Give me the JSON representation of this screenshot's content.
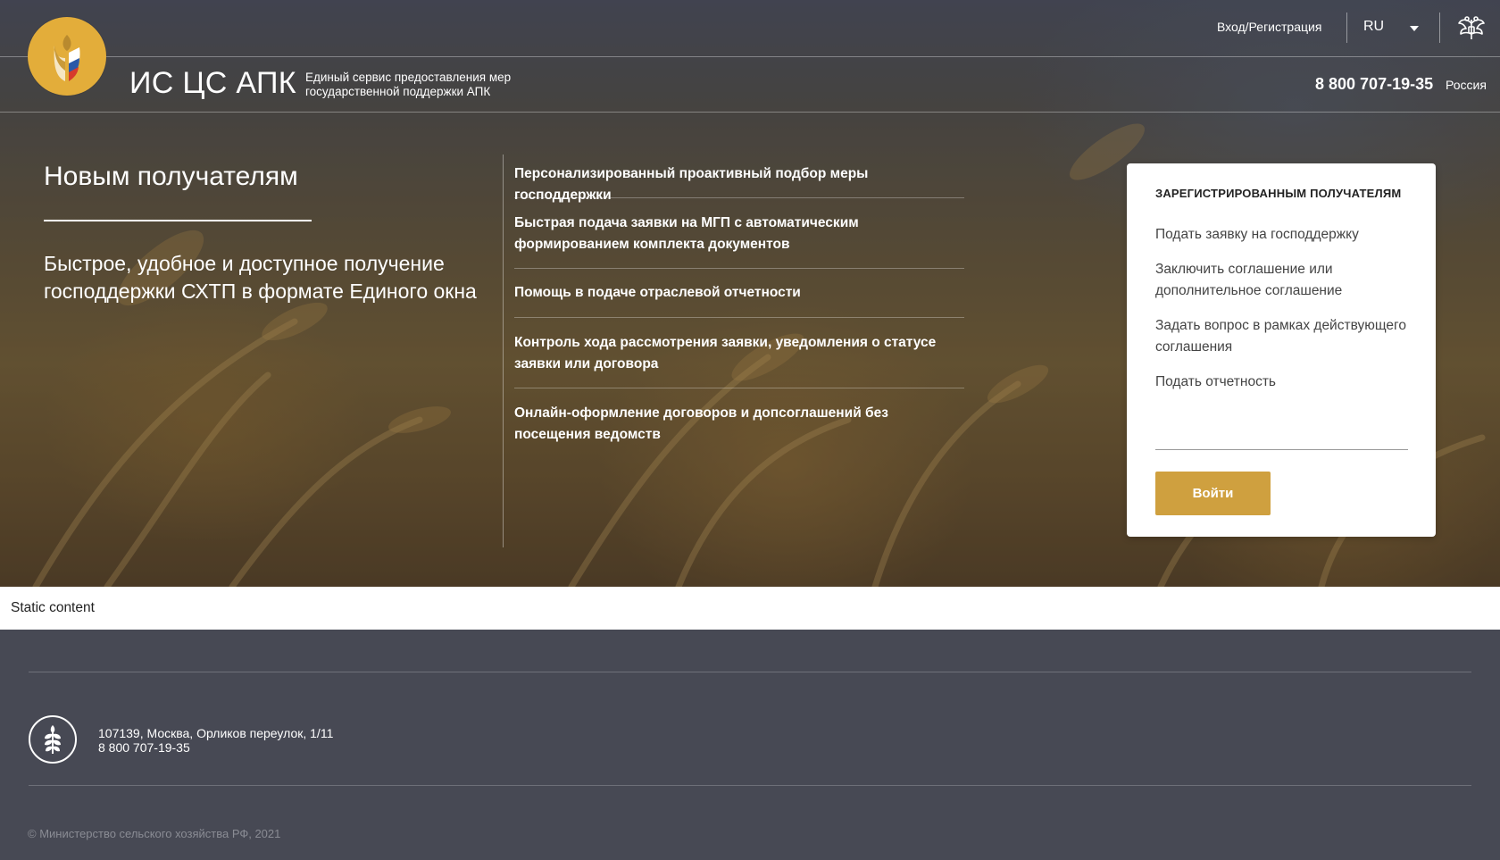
{
  "header": {
    "login_label": "Вход/Регистрация",
    "language": "RU",
    "brand_title": "ИС ЦС АПК",
    "brand_subtitle": "Единый сервис предоставления мер государственной поддержки АПК",
    "phone": "8 800 707-19-35",
    "country": "Россия"
  },
  "hero": {
    "title": "Новым получателям",
    "description": "Быстрое, удобное и доступное получение господдержки СХТП в формате Единого окна",
    "features": [
      "Персонализированный проактивный подбор меры господдержки",
      "Быстрая подача заявки на МГП с автоматическим формированием комплекта документов",
      "Помощь в подаче отраслевой отчетности",
      "Контроль хода рассмотрения заявки, уведомления о статусе заявки или договора",
      "Онлайн-оформление договоров и допсоглашений без посещения ведомств"
    ]
  },
  "card": {
    "title": "ЗАРЕГИСТРИРОВАННЫМ ПОЛУЧАТЕЛЯМ",
    "links": [
      "Подать заявку на господдержку",
      "Заключить соглашение или дополнительное соглашение",
      "Задать вопрос в рамках действующего соглашения",
      "Подать отчетность"
    ],
    "button_label": "Войти"
  },
  "static_strip": {
    "text": "Static content"
  },
  "footer": {
    "address": "107139, Москва, Орликов переулок, 1/11",
    "phone": "8 800 707-19-35",
    "copyright": "© Министерство сельского хозяйства РФ, 2021"
  },
  "colors": {
    "accent_gold": "#cfa03f",
    "logo_gold": "#e3ad3a",
    "footer_bg": "#474954"
  },
  "icons": {
    "logo": "wheat-logo-icon",
    "emblem": "double-headed-eagle-icon",
    "footer_logo": "wheat-circle-icon",
    "language_caret": "caret-down-icon"
  }
}
